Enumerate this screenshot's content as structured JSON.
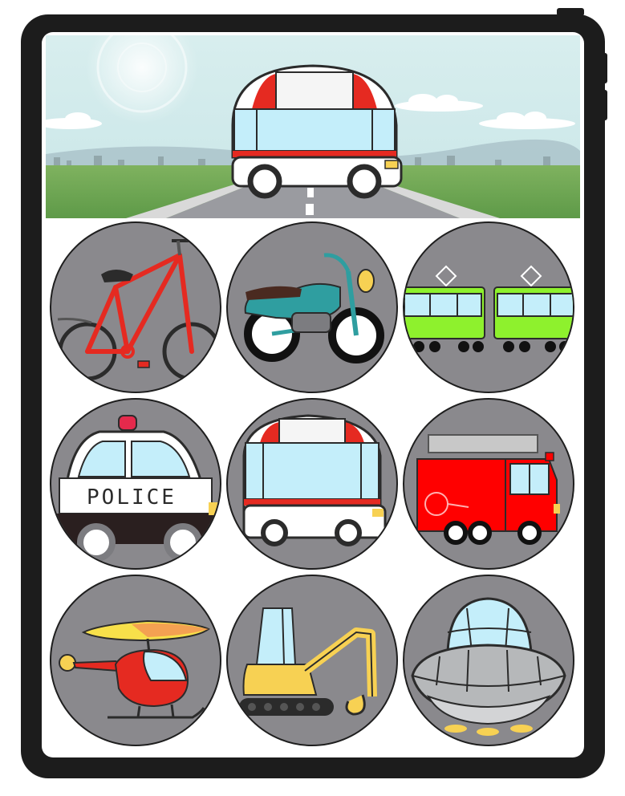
{
  "app": {
    "banner": {
      "vehicle": "ambulance"
    },
    "grid": [
      {
        "vehicle": "bicycle"
      },
      {
        "vehicle": "motorcycle"
      },
      {
        "vehicle": "train"
      },
      {
        "vehicle": "police-car",
        "label": "POLICE"
      },
      {
        "vehicle": "ambulance"
      },
      {
        "vehicle": "fire-truck"
      },
      {
        "vehicle": "helicopter"
      },
      {
        "vehicle": "excavator"
      },
      {
        "vehicle": "ufo"
      }
    ],
    "colors": {
      "device": "#1c1c1c",
      "tile_background": "#8a898d",
      "sky": "#cfe9ea",
      "grass": "#6fa554",
      "road": "#9a9ba0",
      "bicycle": "#e52a21",
      "motorcycle": "#2f9ea0",
      "train": "#8ef12d",
      "fire_truck": "#ff0000",
      "excavator": "#f7d153",
      "ufo": "#b6b8ba",
      "window": "#c4eefa"
    }
  }
}
